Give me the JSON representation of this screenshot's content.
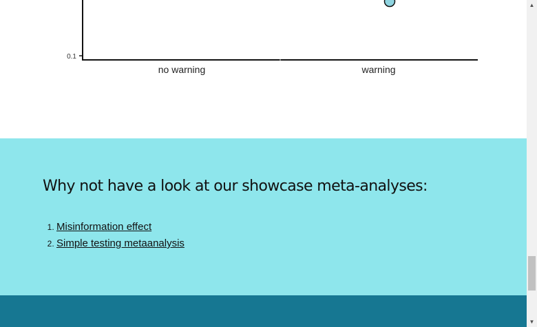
{
  "chart_data": {
    "type": "scatter",
    "categories": [
      "no warning",
      "warning"
    ],
    "y_ticks": [
      "0.1"
    ],
    "y_scale": "log",
    "points": [
      {
        "category": "warning",
        "y": null,
        "color": "#8fd4e0"
      }
    ],
    "title": "",
    "xlabel": "",
    "ylabel": ""
  },
  "showcase": {
    "heading": "Why not have a look at our showcase meta-analyses:",
    "links": [
      "Misinformation effect",
      "Simple testing metaanalysis"
    ],
    "background": "#8ee6ec"
  },
  "footer": {
    "background": "#167792"
  },
  "scrollbar": {
    "up_icon": "▲",
    "down_icon": "▼"
  }
}
